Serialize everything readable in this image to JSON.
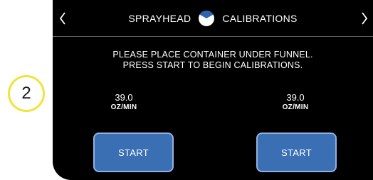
{
  "step_callout": {
    "number": "2"
  },
  "header": {
    "title_left": "SPRAYHEAD",
    "title_right": "CALIBRATIONS",
    "back_icon": "chevron-left-icon",
    "next_icon": "chevron-right-icon",
    "sprayhead_icon": "sprayhead-icon"
  },
  "instructions": {
    "line1": "PLEASE PLACE CONTAINER UNDER FUNNEL.",
    "line2": "PRESS START TO BEGIN CALIBRATIONS."
  },
  "sprayheads": [
    {
      "value": "39.0",
      "unit": "OZ/MIN",
      "button_label": "START"
    },
    {
      "value": "39.0",
      "unit": "OZ/MIN",
      "button_label": "START"
    }
  ],
  "colors": {
    "screen_background": "#000000",
    "button_fill": "#3b6fb4",
    "button_border": "#8fb2de",
    "callout_ring": "#f2e33a"
  }
}
